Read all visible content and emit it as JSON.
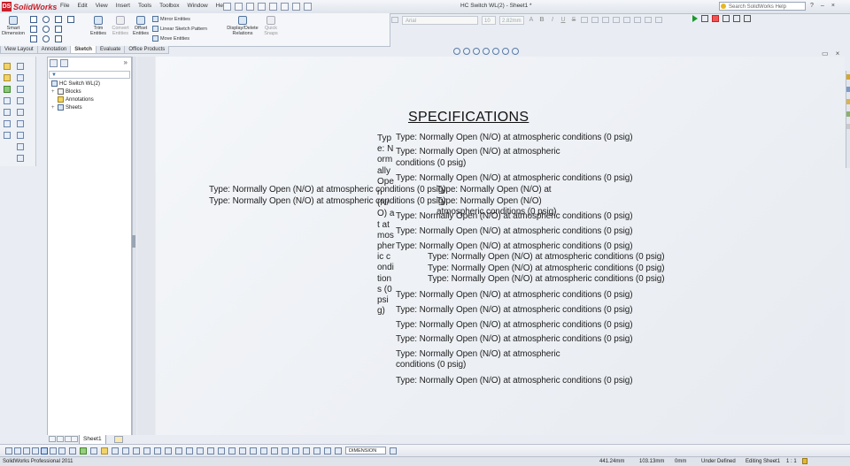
{
  "app": {
    "name": "SolidWorks",
    "document_title": "HC Switch WL(2) - Sheet1 *",
    "search_placeholder": "Search SolidWorks Help"
  },
  "menu": [
    "File",
    "Edit",
    "View",
    "Insert",
    "Tools",
    "Toolbox",
    "Window",
    "Help"
  ],
  "command_manager": {
    "tools": {
      "smart_dimension": "Smart Dimension",
      "trim": "Trim Entities",
      "convert": "Convert Entities",
      "offset": "Offset Entities",
      "mirror": "Mirror Entities",
      "linear_pattern": "Linear Sketch Pattern",
      "move": "Move Entities",
      "display_delete": "Display/Delete Relations",
      "quick_snaps": "Quick Snaps"
    },
    "tabs": [
      "View Layout",
      "Annotation",
      "Sketch",
      "Evaluate",
      "Office Products"
    ],
    "active_tab": "Sketch"
  },
  "format_bar": {
    "font": "Arial",
    "size": "10",
    "size_mm": "2.82mm",
    "buttons": [
      "A",
      "B",
      "I",
      "U",
      "S"
    ]
  },
  "feature_manager": {
    "root": "HC Switch WL(2)",
    "items": [
      "Blocks",
      "Annotations",
      "Sheets"
    ]
  },
  "drawing": {
    "title": "SPECIFICATIONS",
    "spec_text": "Type: Normally Open (N/O) at atmospheric conditions (0 psig)",
    "wrapped_a_line1": "Type: Normally Open (N/O) at atmospheric",
    "wrapped_a_line2": "conditions (0 psig)",
    "left_short": "Type: Normally Open (N/O) at",
    "overlap_a": "Type: Normally Open (N/O)",
    "overlap_b": "atmospheric conditions (0 psig)",
    "narrow_column": "Type: Normally Open (N/O) at atmospheric conditions (0 psig)"
  },
  "sheet_tab": "Sheet1",
  "layer": "DIMENSION",
  "status": {
    "app": "SolidWorks Professional 2011",
    "x": "441.24mm",
    "y": "103.13mm",
    "z": "0mm",
    "state": "Under Defined",
    "mode": "Editing Sheet1",
    "scale": "1 : 1"
  }
}
